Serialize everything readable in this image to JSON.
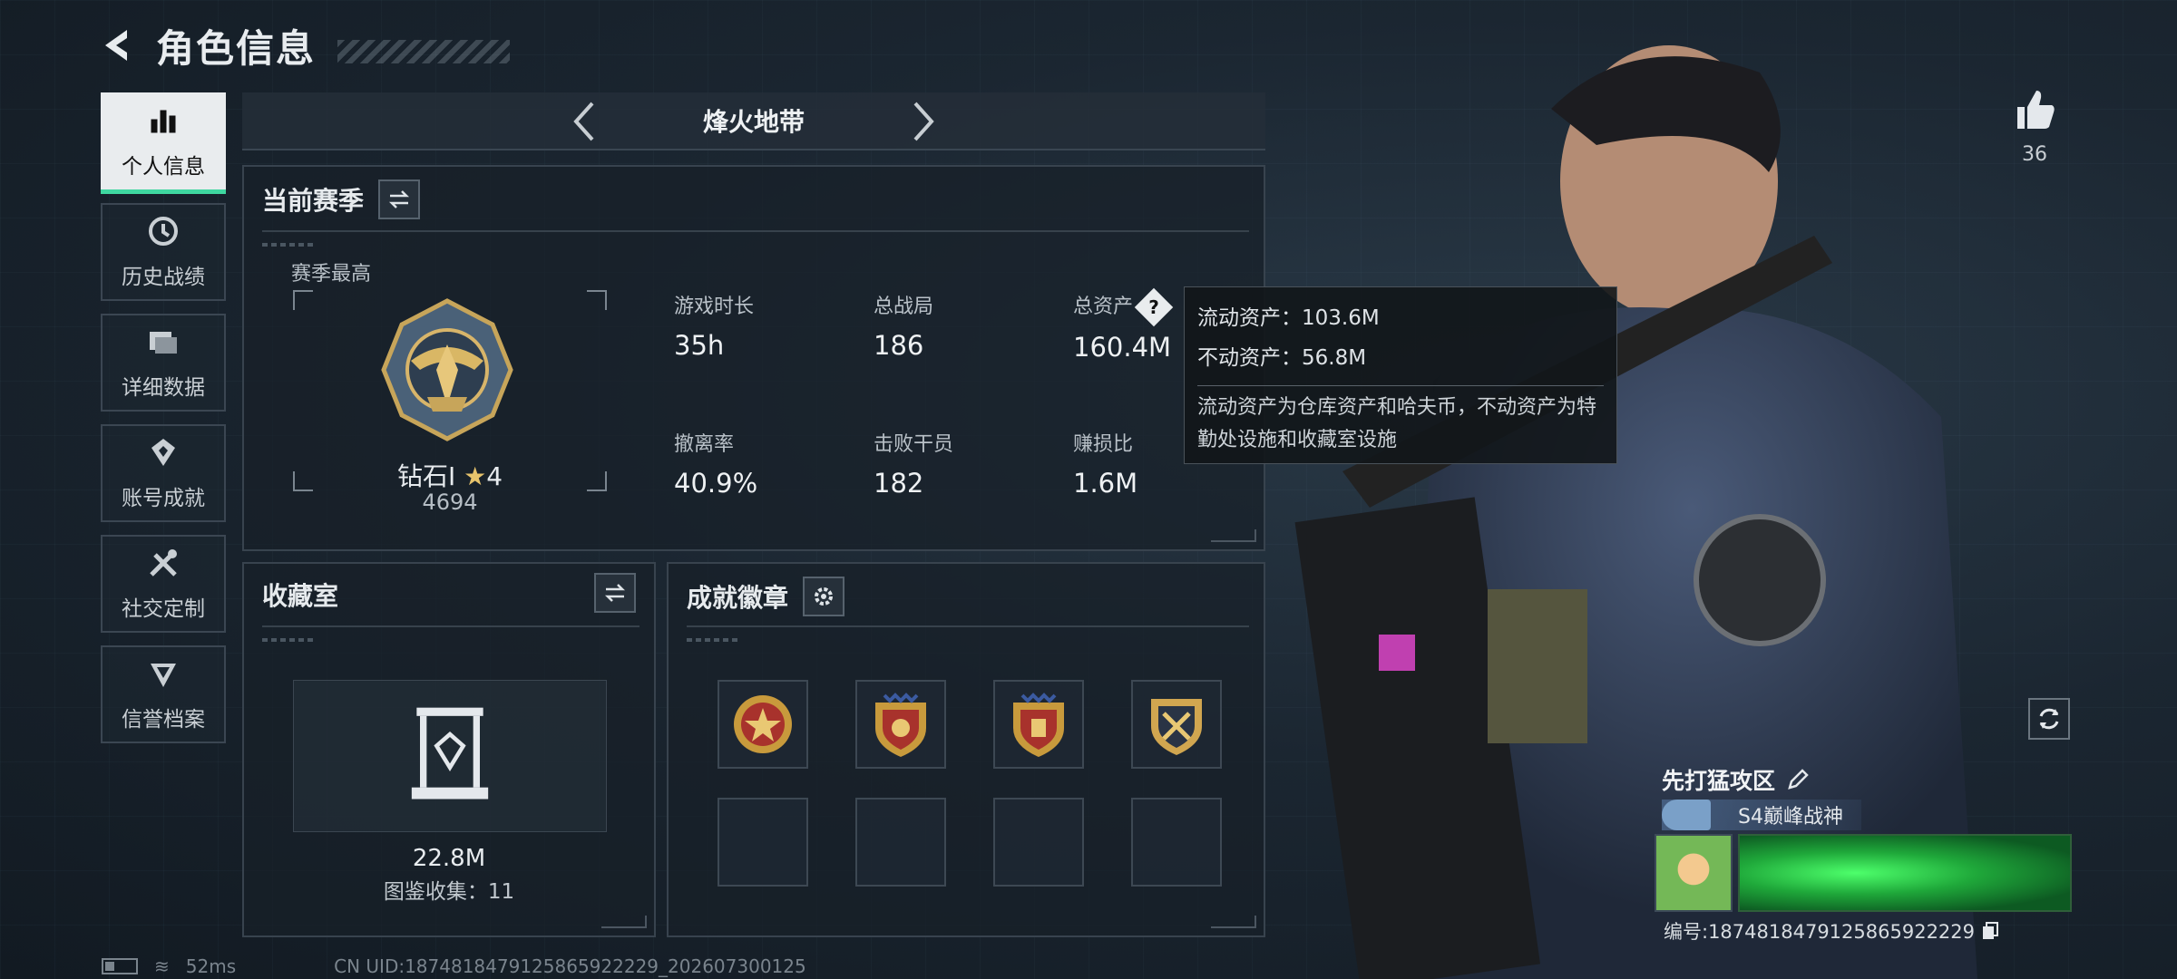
{
  "header": {
    "title": "角色信息"
  },
  "nav": {
    "items": [
      {
        "label": "个人信息",
        "icon": "bar-chart-icon",
        "active": true
      },
      {
        "label": "历史战绩",
        "icon": "history-clock-icon"
      },
      {
        "label": "详细数据",
        "icon": "folder-icon"
      },
      {
        "label": "账号成就",
        "icon": "achievement-icon"
      },
      {
        "label": "社交定制",
        "icon": "tools-icon"
      },
      {
        "label": "信誉档案",
        "icon": "credit-shield-icon"
      }
    ]
  },
  "mode_tab": {
    "title": "烽火地带"
  },
  "season": {
    "title": "当前赛季",
    "best_label": "赛季最高",
    "rank": {
      "name": "钻石Ⅰ",
      "stars": "4",
      "score": "4694"
    },
    "stats": [
      {
        "label": "游戏时长",
        "value": "35h"
      },
      {
        "label": "总战局",
        "value": "186"
      },
      {
        "label": "总资产",
        "value": "160.4M"
      },
      {
        "label": "撤离率",
        "value": "40.9%"
      },
      {
        "label": "击败干员",
        "value": "182"
      },
      {
        "label": "赚损比",
        "value": "1.6M"
      }
    ]
  },
  "tooltip": {
    "liquid": "流动资产：103.6M",
    "fixed": "不动资产：56.8M",
    "description": "流动资产为仓库资产和哈夫币，不动资产为特勤处设施和收藏室设施"
  },
  "collection": {
    "title": "收藏室",
    "value": "22.8M",
    "count_text": "图鉴收集：11"
  },
  "achievements": {
    "title": "成就徽章"
  },
  "profile": {
    "like_count": "36",
    "name": "先打猛攻区",
    "title_badge": "S4巅峰战神",
    "uid_line": "编号:1874818479125865922229"
  },
  "status": {
    "ping": "52ms",
    "uid": "CN UID:1874818479125865922229_202607300125"
  },
  "colors": {
    "accent": "#3fd7a0",
    "panel_border": "#38434e",
    "background": "#1b2631"
  }
}
